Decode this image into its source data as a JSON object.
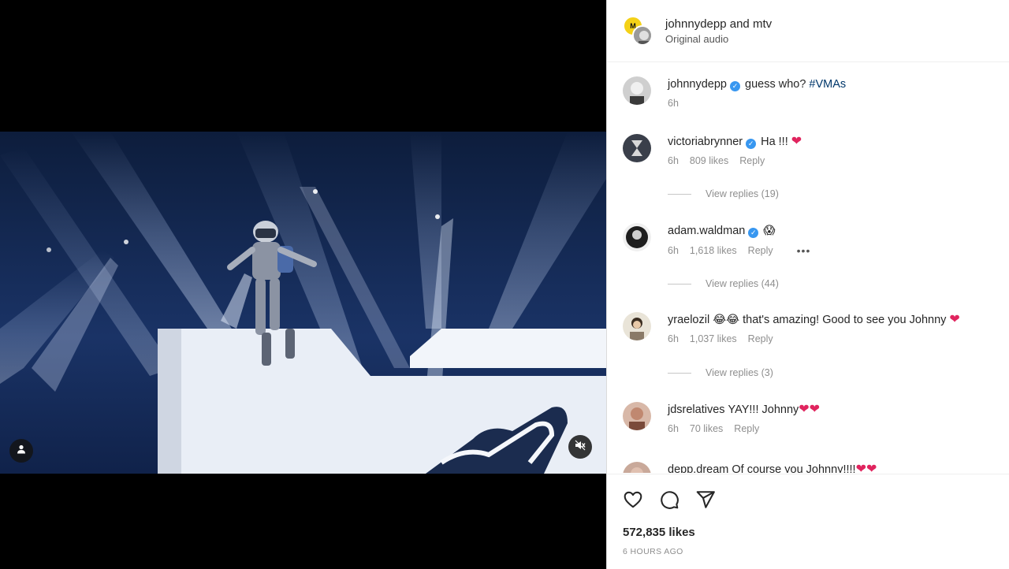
{
  "header": {
    "user1": "johnnydepp",
    "joiner": "and",
    "user2": "mtv",
    "audio": "Original audio"
  },
  "caption": {
    "username": "johnnydepp",
    "text": "guess who?",
    "hashtag": "#VMAs",
    "time": "6h"
  },
  "comments": [
    {
      "username": "victoriabrynner",
      "verified": true,
      "text": "Ha !!!",
      "hearts": "❤",
      "time": "6h",
      "likes": "809 likes",
      "reply": "Reply",
      "view_replies": "View replies (19)"
    },
    {
      "username": "adam.waldman",
      "verified": true,
      "text": "😱",
      "hearts": "",
      "time": "6h",
      "likes": "1,618 likes",
      "reply": "Reply",
      "more": "•••",
      "view_replies": "View replies (44)"
    },
    {
      "username": "yraelozil",
      "verified": false,
      "text": "😂😂 that's amazing! Good to see you Johnny",
      "hearts": "❤",
      "time": "6h",
      "likes": "1,037 likes",
      "reply": "Reply",
      "view_replies": "View replies (3)"
    },
    {
      "username": "jdsrelatives",
      "verified": false,
      "text": "YAY!!! Johnny",
      "hearts": "❤❤",
      "time": "6h",
      "likes": "70 likes",
      "reply": "Reply"
    },
    {
      "username": "depp.dream",
      "verified": false,
      "text": "Of course you Johnny!!!!",
      "hearts": "❤❤"
    }
  ],
  "actions": {
    "likes": "572,835 likes",
    "time_ago": "6 HOURS AGO"
  },
  "colors": {
    "heart": "#e0245e",
    "verified": "#3897f0",
    "hashtag": "#00376b",
    "muted_text": "#8e8e8e"
  }
}
